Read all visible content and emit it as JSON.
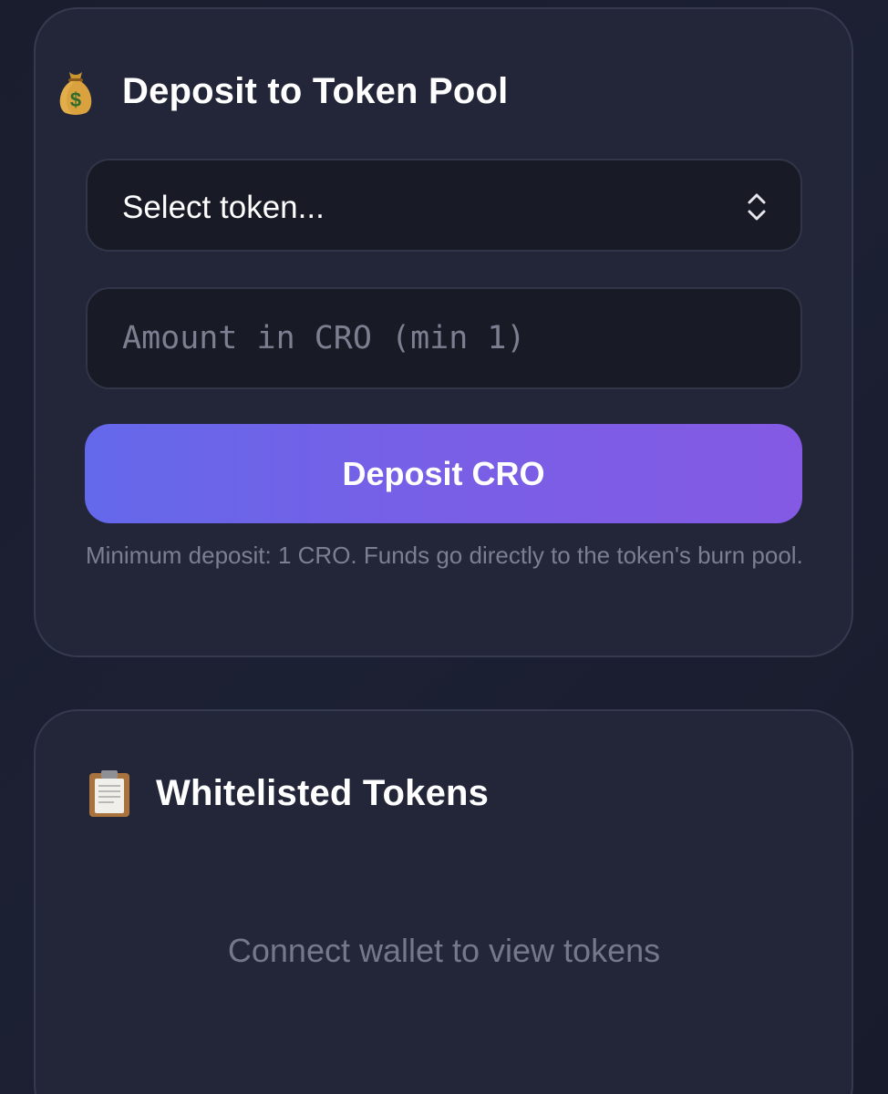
{
  "deposit_card": {
    "icon": "money-bag-icon",
    "title": "Deposit to Token Pool",
    "token_select": {
      "selected": "Select token..."
    },
    "amount_input": {
      "value": "",
      "placeholder": "Amount in CRO (min 1)"
    },
    "deposit_button_label": "Deposit CRO",
    "note": "Minimum deposit: 1 CRO. Funds go directly to the token's burn pool."
  },
  "tokens_card": {
    "icon": "clipboard-icon",
    "title": "Whitelisted Tokens",
    "empty_message": "Connect wallet to view tokens"
  },
  "colors": {
    "background": "#1b1e30",
    "card": "#222638",
    "button_gradient_start": "#6468ea",
    "button_gradient_end": "#845ae4",
    "muted_text": "#7b7f90"
  }
}
